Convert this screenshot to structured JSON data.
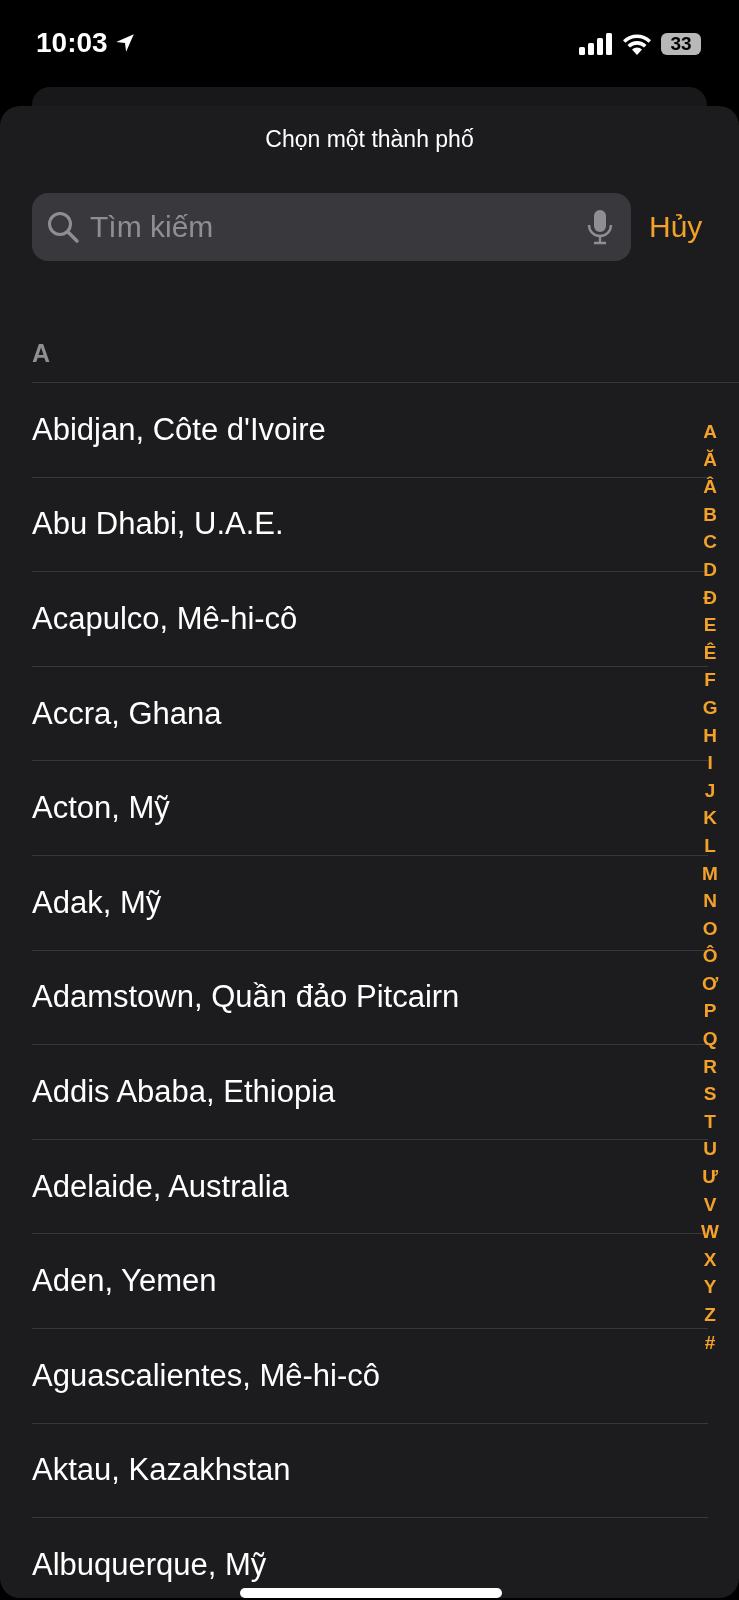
{
  "status_bar": {
    "time": "10:03",
    "battery": "33"
  },
  "sheet": {
    "title": "Chọn một thành phố"
  },
  "search": {
    "placeholder": "Tìm kiếm",
    "cancel": "Hủy"
  },
  "sections": [
    {
      "header": "A",
      "rows": [
        "Abidjan, Côte d'Ivoire",
        "Abu Dhabi, U.A.E.",
        "Acapulco, Mê-hi-cô",
        "Accra, Ghana",
        "Acton, Mỹ",
        "Adak, Mỹ",
        "Adamstown, Quần đảo Pitcairn",
        "Addis Ababa, Ethiopia",
        "Adelaide, Australia",
        "Aden, Yemen",
        "Aguascalientes, Mê-hi-cô",
        "Aktau, Kazakhstan",
        "Albuquerque, Mỹ"
      ]
    }
  ],
  "index": [
    "A",
    "Ă",
    "Â",
    "B",
    "C",
    "D",
    "Đ",
    "E",
    "Ê",
    "F",
    "G",
    "H",
    "I",
    "J",
    "K",
    "L",
    "M",
    "N",
    "O",
    "Ô",
    "Ơ",
    "P",
    "Q",
    "R",
    "S",
    "T",
    "U",
    "Ư",
    "V",
    "W",
    "X",
    "Y",
    "Z",
    "#"
  ]
}
